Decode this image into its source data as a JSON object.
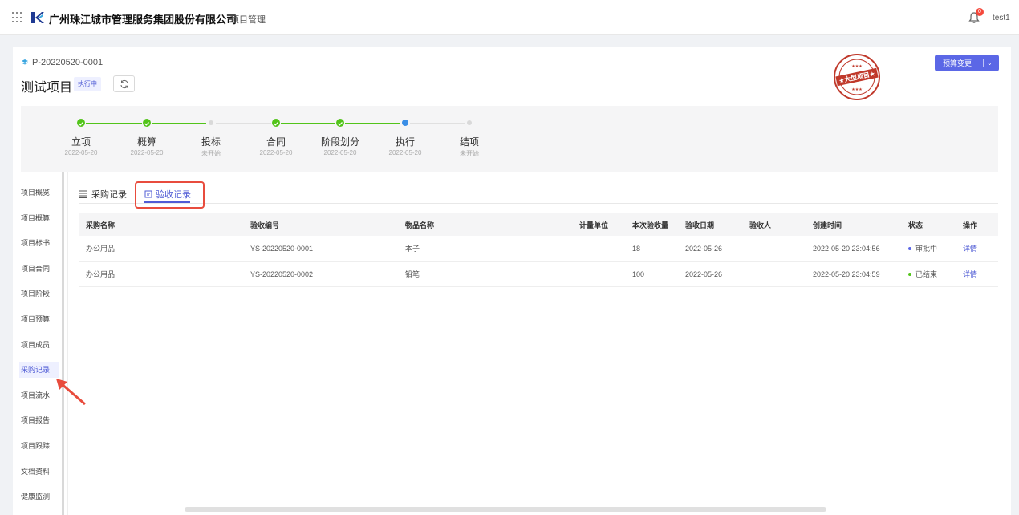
{
  "header": {
    "company": "广州珠江城市管理服务集团股份有限公司",
    "module": "项目管理",
    "notification_count": "0",
    "user": "test1"
  },
  "project": {
    "code": "P-20220520-0001",
    "name": "测试项目",
    "status": "执行中",
    "stamp_text": "大型项目",
    "budget_button": "预算变更"
  },
  "steps": [
    {
      "name": "立项",
      "date": "2022-05-20",
      "state": "done"
    },
    {
      "name": "概算",
      "date": "2022-05-20",
      "state": "done"
    },
    {
      "name": "投标",
      "date": "未开始",
      "state": "todo"
    },
    {
      "name": "合同",
      "date": "2022-05-20",
      "state": "done"
    },
    {
      "name": "阶段划分",
      "date": "2022-05-20",
      "state": "done"
    },
    {
      "name": "执行",
      "date": "2022-05-20",
      "state": "current"
    },
    {
      "name": "结项",
      "date": "未开始",
      "state": "todo"
    }
  ],
  "sidebar": {
    "items": [
      "项目概览",
      "项目概算",
      "项目标书",
      "项目合同",
      "项目阶段",
      "项目预算",
      "项目成员",
      "采购记录",
      "项目流水",
      "项目报告",
      "项目跟踪",
      "文档资料",
      "健康监测"
    ],
    "active_index": 7
  },
  "tabs": [
    {
      "label": "采购记录",
      "icon": "list-icon"
    },
    {
      "label": "验收记录",
      "icon": "doc-icon"
    }
  ],
  "table": {
    "headers": [
      "采购名称",
      "验收编号",
      "物品名称",
      "计量单位",
      "本次验收量",
      "验收日期",
      "验收人",
      "创建时间",
      "状态",
      "操作"
    ],
    "rows": [
      [
        "办公用品",
        "YS-20220520-0001",
        "本子",
        "",
        "18",
        "2022-05-26",
        "",
        "2022-05-20 23:04:56",
        "审批中",
        "详情"
      ],
      [
        "办公用品",
        "YS-20220520-0002",
        "铅笔",
        "",
        "100",
        "2022-05-26",
        "",
        "2022-05-20 23:04:59",
        "已结束",
        "详情"
      ]
    ],
    "status_colors": {
      "审批中": "#5b67e6",
      "已结束": "#52c41a"
    }
  },
  "colors": {
    "accent": "#5b67e6",
    "success": "#52c41a",
    "highlight": "#e84c3d"
  }
}
